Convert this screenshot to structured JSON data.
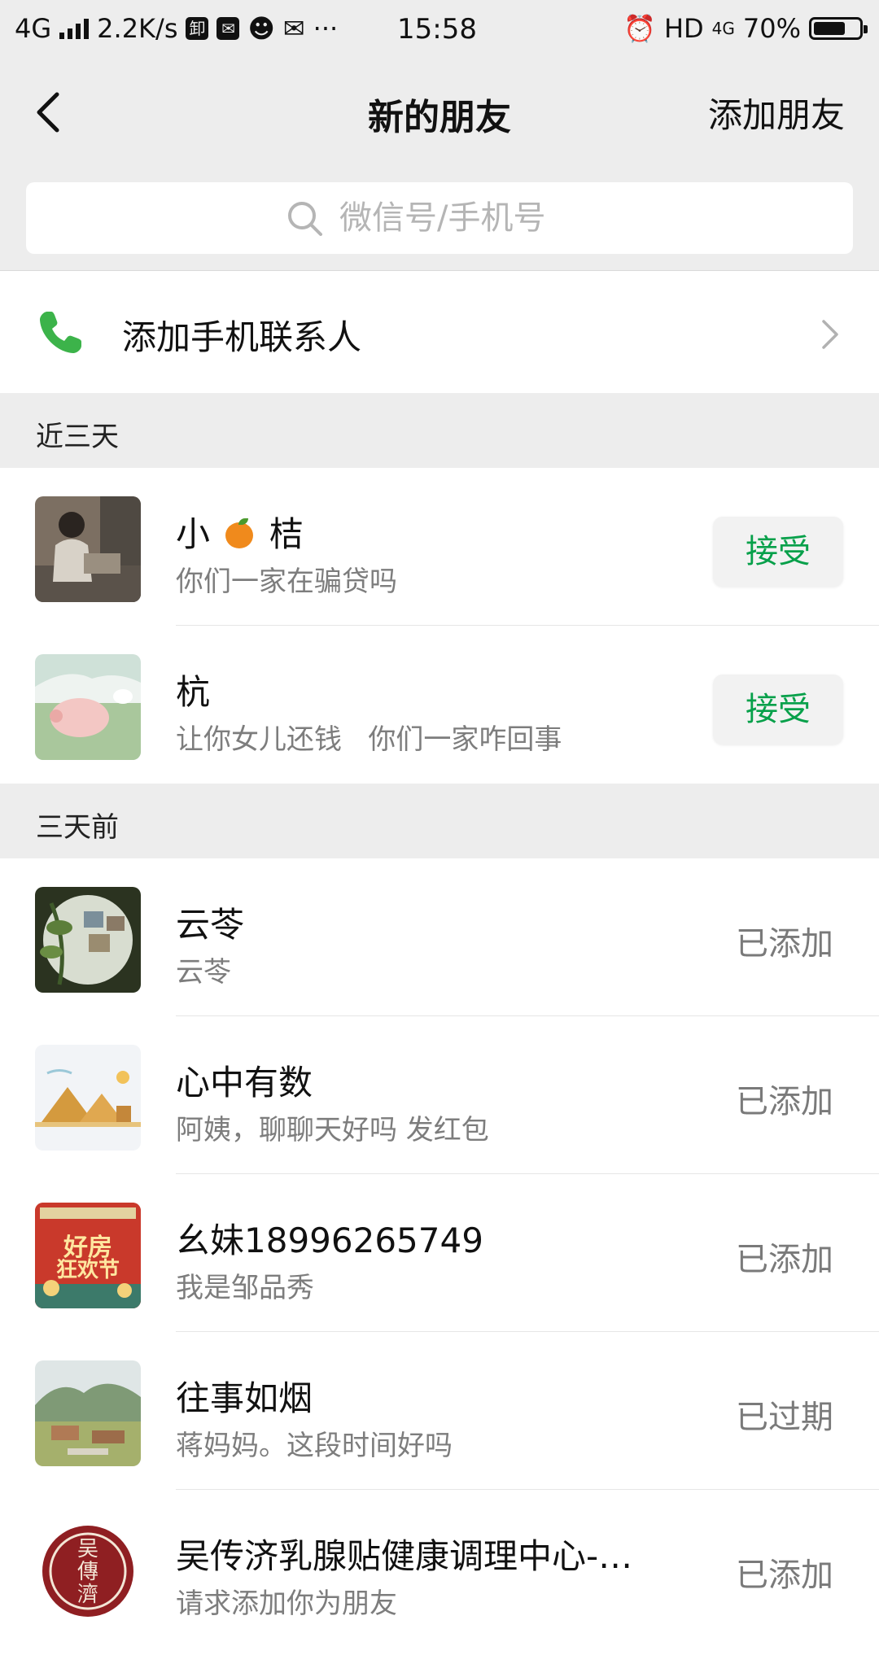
{
  "status_bar": {
    "network": "4G",
    "speed": "2.2K/s",
    "time": "15:58",
    "hd": "HD",
    "net2": "4G",
    "battery_text": "70%",
    "battery_level": 0.7
  },
  "nav": {
    "title": "新的朋友",
    "add_friend": "添加朋友"
  },
  "search": {
    "placeholder": "微信号/手机号"
  },
  "phone_contacts": {
    "label": "添加手机联系人"
  },
  "sections": {
    "recent": "近三天",
    "earlier": "三天前"
  },
  "recent_requests": [
    {
      "name_part1": "小",
      "name_part2": "桔",
      "message": "你们一家在骗贷吗",
      "action": "接受"
    },
    {
      "name": "杭",
      "message": "让你女儿还钱   你们一家咋回事",
      "action": "接受"
    }
  ],
  "earlier_requests": [
    {
      "name": "云苓",
      "message": "云苓",
      "status": "已添加"
    },
    {
      "name": "心中有数",
      "message": "阿姨，聊聊天好吗 发红包",
      "status": "已添加"
    },
    {
      "name": "幺妹18996265749",
      "message": "我是邹品秀",
      "status": "已添加",
      "avatar_text_1": "好房",
      "avatar_text_2": "狂欢节"
    },
    {
      "name": "往事如烟",
      "message": "蒋妈妈。这段时间好吗",
      "status": "已过期"
    },
    {
      "name": "吴传济乳腺贴健康调理中心-…",
      "message": "请求添加你为朋友",
      "status": "已添加",
      "avatar_text": "吴傳濟"
    }
  ],
  "colors": {
    "accent_green": "#07a04a",
    "phone_green": "#3cb34a",
    "background_gray": "#ededed"
  }
}
